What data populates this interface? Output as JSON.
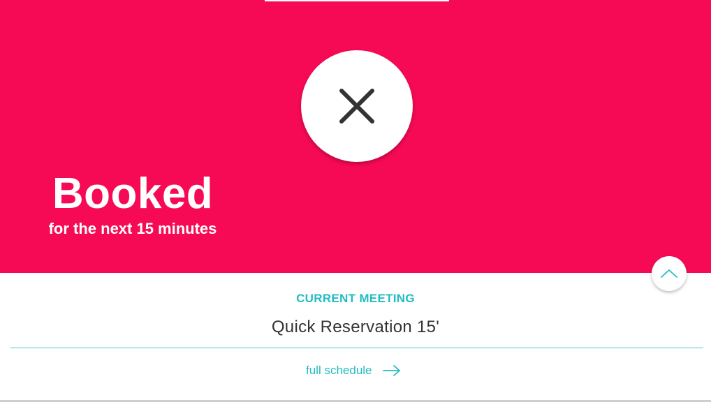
{
  "status": {
    "title": "Booked",
    "subtitle": "for the next 15 minutes",
    "color": "#f70a55",
    "action_icon": "close-icon"
  },
  "collapse": {
    "icon": "chevron-up-icon"
  },
  "current_meeting": {
    "label": "CURRENT MEETING",
    "title": "Quick Reservation 15'"
  },
  "schedule": {
    "link_label": "full schedule",
    "icon": "arrow-right-icon"
  },
  "accent_color": "#22bcc2"
}
